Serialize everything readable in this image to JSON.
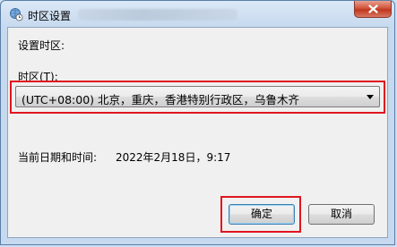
{
  "window": {
    "title": "时区设置",
    "close_icon": "close-icon"
  },
  "dialog": {
    "heading": "设置时区:",
    "timezone_label": "时区(T):",
    "timezone_selected": "(UTC+08:00) 北京，重庆，香港特别行政区，乌鲁木齐",
    "datetime_label": "当前日期和时间:",
    "datetime_value": "2022年2月18日，9:17"
  },
  "buttons": {
    "ok": "确定",
    "cancel": "取消"
  },
  "colors": {
    "highlight": "#e0161e",
    "title_gradient_top": "#dbe8f6",
    "close_button": "#c0361d",
    "client_bg": "#f0f0f0"
  }
}
